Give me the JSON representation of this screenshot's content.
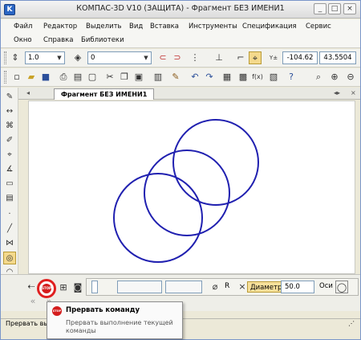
{
  "window": {
    "title": "КОМПАС-3D V10 (ЗАЩИТА) - Фрагмент БЕЗ ИМЕНИ1",
    "minimize": "_",
    "maximize": "□",
    "close": "×"
  },
  "menu": {
    "row1": [
      "Файл",
      "Редактор",
      "Выделить",
      "Вид",
      "Вставка",
      "Инструменты",
      "Спецификация",
      "Сервис"
    ],
    "row2": [
      "Окно",
      "Справка",
      "Библиотеки"
    ]
  },
  "toolbar1": {
    "scale_value": "1.0",
    "layer_value": "0",
    "coord_label": "Y±",
    "x_coord": "-104.62",
    "y_coord": "43.5504"
  },
  "document": {
    "tab_label": "Фрагмент БЕЗ ИМЕНИ1",
    "circle_color": "#2020b0"
  },
  "property_panel": {
    "option_r": "R",
    "diameter_label": "Диаметр",
    "diameter_value": "50.0",
    "axes_label": "Оси"
  },
  "status": {
    "text": "Прервать выпо"
  },
  "tooltip": {
    "title": "Прервать команду",
    "description": "Прервать выполнение текущей команды",
    "icon_text": "STOP"
  },
  "stop_icon_text": "STOP"
}
